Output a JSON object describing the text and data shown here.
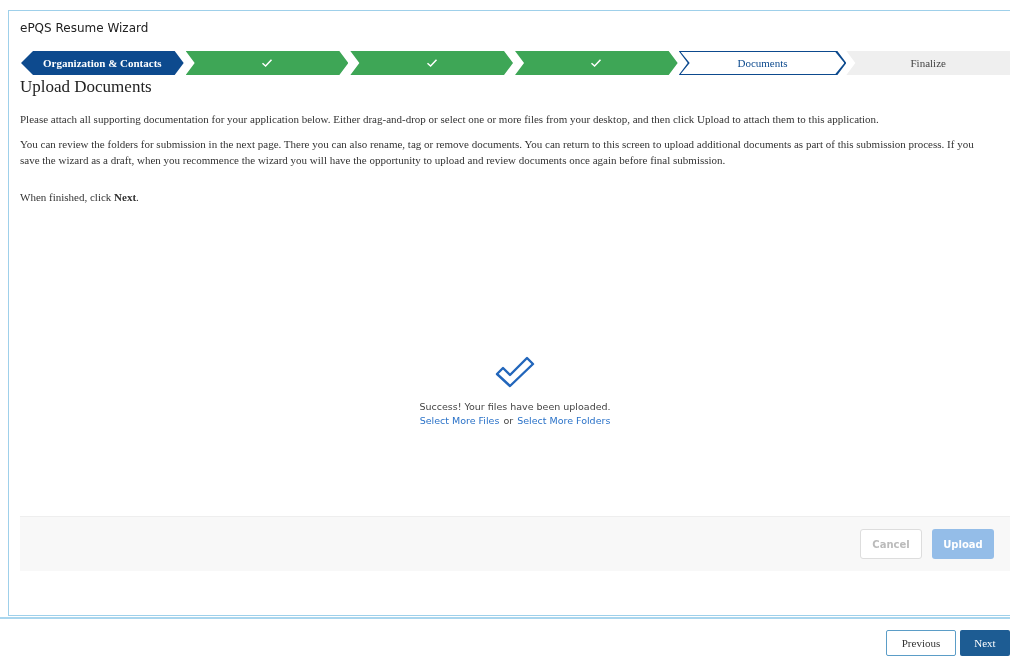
{
  "window": {
    "title": "ePQS Resume Wizard"
  },
  "steps": [
    {
      "label": "Organization & Contacts",
      "kind": "first"
    },
    {
      "kind": "done"
    },
    {
      "kind": "done"
    },
    {
      "kind": "done"
    },
    {
      "label": "Documents",
      "kind": "current"
    },
    {
      "label": "Finalize",
      "kind": "todo"
    }
  ],
  "heading": "Upload Documents",
  "paragraphs": [
    "Please attach all supporting documentation for your application below. Either drag-and-drop or select one or more files from your desktop, and then click Upload to attach them to this application.",
    "You can review the folders for submission in the next page. There you can also rename, tag or remove documents. You can return to this screen to upload additional documents as part of this submission process. If you save the wizard as a draft, when you recommence the wizard you will have the opportunity to upload and review documents once again before final submission.",
    "When finished, click **Next**."
  ],
  "upload": {
    "message": "Success! Your files have been uploaded.",
    "link_files": "Select More Files",
    "separator": "or",
    "link_folders": "Select More Folders",
    "buttons": [
      {
        "label": "Cancel",
        "kind": "secondary",
        "disabled": true
      },
      {
        "label": "Upload",
        "kind": "primary",
        "disabled": true
      }
    ]
  },
  "footer": {
    "buttons": [
      {
        "label": "Previous",
        "kind": "secondary",
        "disabled": false
      },
      {
        "label": "Next",
        "kind": "primary",
        "disabled": false
      }
    ]
  }
}
